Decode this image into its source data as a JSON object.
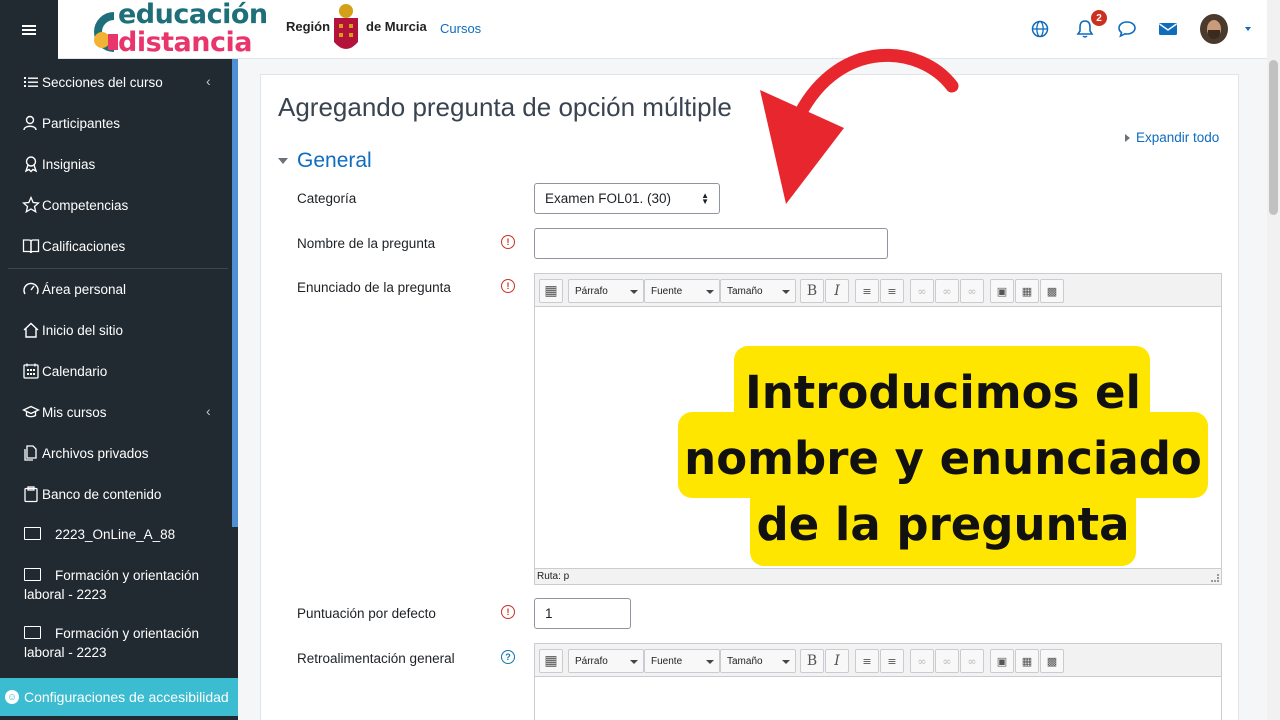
{
  "header": {
    "logo_line1": "educación",
    "logo_line2": "distancia",
    "region_left": "Región",
    "region_right": "de Murcia",
    "nav_link": "Cursos",
    "notification_count": "2"
  },
  "sidebar": {
    "items": [
      {
        "label": "Secciones del curso",
        "icon": "list-icon"
      },
      {
        "label": "Participantes",
        "icon": "users-icon"
      },
      {
        "label": "Insignias",
        "icon": "badge-icon"
      },
      {
        "label": "Competencias",
        "icon": "star-icon"
      },
      {
        "label": "Calificaciones",
        "icon": "gradebook-icon"
      },
      {
        "label": "Área personal",
        "icon": "dashboard-icon"
      },
      {
        "label": "Inicio del sitio",
        "icon": "home-icon"
      },
      {
        "label": "Calendario",
        "icon": "calendar-icon"
      },
      {
        "label": "Mis cursos",
        "icon": "mortarboard-icon"
      },
      {
        "label": "Archivos privados",
        "icon": "files-icon"
      },
      {
        "label": "Banco de contenido",
        "icon": "clipboard-icon"
      }
    ],
    "courses": [
      "2223_OnLine_A_88",
      "Formación y orientación laboral - 2223",
      "Formación y orientación laboral - 2223"
    ],
    "accessibility": "Configuraciones de accesibilidad"
  },
  "main": {
    "title": "Agregando pregunta de opción múltiple",
    "expand_all": "Expandir todo",
    "section": "General",
    "fields": {
      "category_label": "Categoría",
      "category_value": "Examen FOL01. (30)",
      "name_label": "Nombre de la pregunta",
      "statement_label": "Enunciado de la pregunta",
      "score_label": "Puntuación por defecto",
      "score_value": "1",
      "feedback_label": "Retroalimentación general"
    },
    "editor": {
      "paragraph": "Párrafo",
      "font": "Fuente",
      "size": "Tamaño",
      "path": "Ruta: p"
    }
  },
  "overlay": {
    "callout_line1": "Introducimos el",
    "callout_line2": "nombre y enunciado",
    "callout_line3": "de la pregunta",
    "callout_color": "#ffe600",
    "arrow_color": "#e8262e"
  }
}
